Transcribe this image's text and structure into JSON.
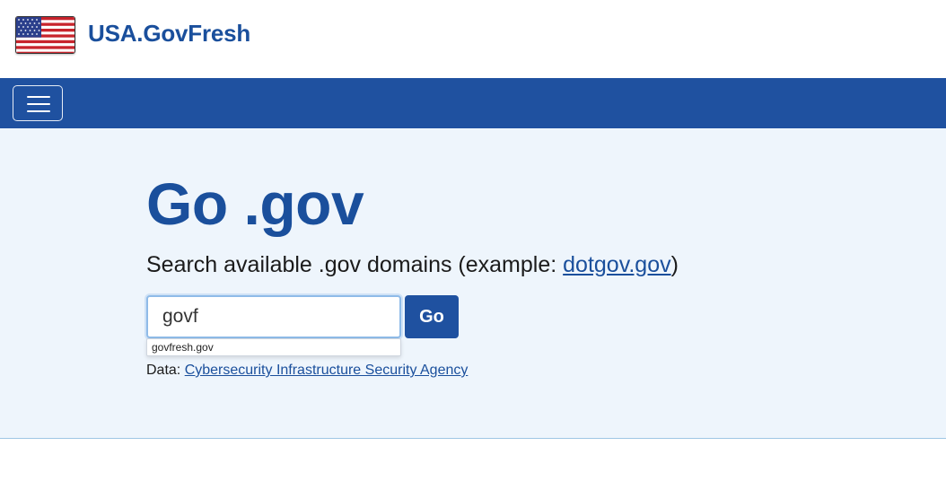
{
  "header": {
    "site_title": "USA.GovFresh",
    "logo_icon": "us-flag-icon"
  },
  "navbar": {
    "menu_icon": "hamburger-menu-icon"
  },
  "hero": {
    "title": "Go .gov",
    "subtitle_prefix": "Search available .gov domains (example: ",
    "subtitle_link": "dotgov.gov",
    "subtitle_suffix": ")"
  },
  "search": {
    "value": "govf",
    "button_label": "Go",
    "suggestions": [
      "govfresh.gov"
    ]
  },
  "data_source": {
    "label": "Data: ",
    "link": "Cybersecurity Infrastructure Security Agency"
  },
  "colors": {
    "brand_blue": "#1f51a0",
    "hero_background": "#eef5fc"
  }
}
